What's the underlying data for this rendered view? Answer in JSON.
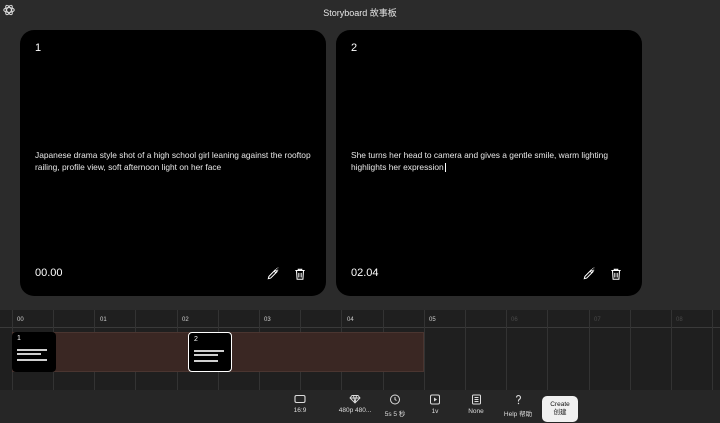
{
  "header": {
    "title": "Storyboard 故事板",
    "logo_icon": "openai-logo-icon"
  },
  "cards": [
    {
      "number": "1",
      "prompt": "Japanese drama style shot of a high school girl leaning against the rooftop railing, profile view, soft afternoon light on her face",
      "time": "00.00"
    },
    {
      "number": "2",
      "prompt": "She turns her head to camera and gives a gentle smile, warm lighting highlights her expression",
      "time": "02.04"
    }
  ],
  "timeline": {
    "ticks": [
      "00",
      "01",
      "02",
      "03",
      "04",
      "05",
      "06",
      "07",
      "08"
    ],
    "active_ticks": 6,
    "clips": [
      {
        "number": "1"
      },
      {
        "number": "2"
      }
    ]
  },
  "toolbar": {
    "aspect": "16:9",
    "resolution": "480p 480...",
    "duration": "5s 5 秒",
    "variations": "1v",
    "preset": "None",
    "help": "Help 帮助",
    "create_line1": "Create",
    "create_line2": "创建"
  },
  "colors": {
    "background": "#2b2b2b",
    "card": "#000000",
    "track": "#3a2723",
    "create_button": "#f1f1f1"
  }
}
